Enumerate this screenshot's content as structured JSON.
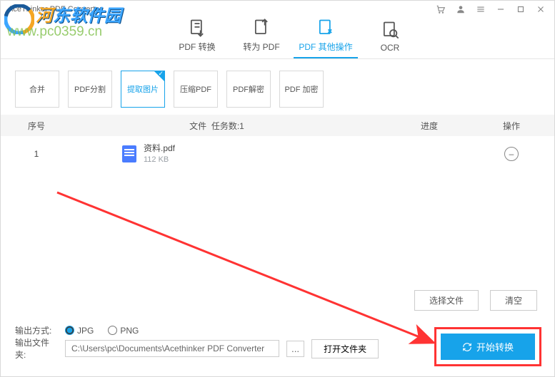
{
  "window_title": "AceThinker PDF Converter",
  "watermark": {
    "brand": "河东软件园",
    "url": "www.pc0359.cn"
  },
  "toolbar": [
    {
      "label": "PDF 转换",
      "id": "convert"
    },
    {
      "label": "转为 PDF",
      "id": "to-pdf"
    },
    {
      "label": "PDF 其他操作",
      "id": "other",
      "active": true
    },
    {
      "label": "OCR",
      "id": "ocr"
    }
  ],
  "subtabs": [
    {
      "label": "合并"
    },
    {
      "label": "PDF分割"
    },
    {
      "label": "提取图片",
      "active": true
    },
    {
      "label": "压缩PDF"
    },
    {
      "label": "PDF解密"
    },
    {
      "label": "PDF 加密"
    }
  ],
  "columns": {
    "idx": "序号",
    "file": "文件",
    "task_count_label": "任务数:1",
    "progress": "进度",
    "op": "操作"
  },
  "rows": [
    {
      "idx": "1",
      "name": "资料.pdf",
      "size": "112 KB"
    }
  ],
  "buttons": {
    "select": "选择文件",
    "clear": "清空",
    "open_folder": "打开文件夹",
    "start": "开始转换",
    "browse": "..."
  },
  "output_format": {
    "label": "输出方式:",
    "options": [
      "JPG",
      "PNG"
    ],
    "selected": "JPG"
  },
  "output_path": {
    "label": "输出文件夹:",
    "value": "C:\\Users\\pc\\Documents\\Acethinker PDF Converter"
  }
}
